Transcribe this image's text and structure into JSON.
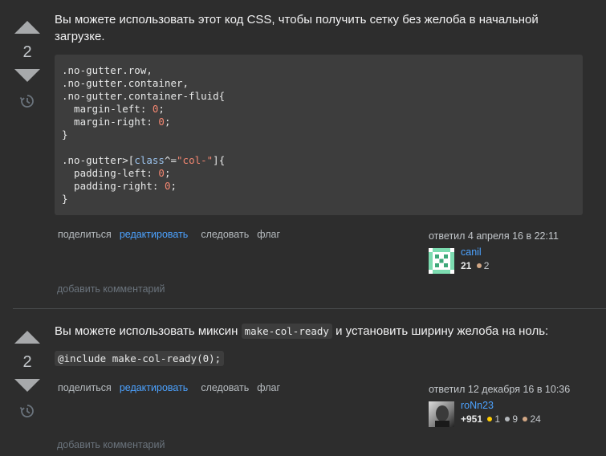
{
  "answers": [
    {
      "votes": "2",
      "text": "Вы можете использовать этот код CSS, чтобы получить сетку без желоба в начальной загрузке.",
      "code": {
        "selector1": ".no-gutter.row,",
        "selector2": ".no-gutter.container,",
        "selector3": ".no-gutter.container-fluid{",
        "prop_ml": "  margin-left: ",
        "prop_mr": "  margin-right: ",
        "zero": "0",
        "semi": ";",
        "close": "}",
        "sel_prefix": ".no-gutter>[",
        "attr": "class",
        "op": "^=",
        "str": "\"col-\"",
        "sel_suffix": "]{",
        "prop_pl": "  padding-left: ",
        "prop_pr": "  padding-right: "
      },
      "menu": {
        "share": "поделиться",
        "edit": "редактировать",
        "follow": "следовать",
        "flag": "флаг"
      },
      "signature": {
        "action": "ответил 4 апреля 16 в 22:11",
        "user": "canil",
        "reputation": "21",
        "bronze": "2"
      },
      "add_comment": "добавить комментарий"
    },
    {
      "votes": "2",
      "text_before": "Вы можете использовать миксин ",
      "inline_code": "make-col-ready",
      "text_after": " и установить ширину желоба на ноль:",
      "code_line": "@include make-col-ready(0);",
      "menu": {
        "share": "поделиться",
        "edit": "редактировать",
        "follow": "следовать",
        "flag": "флаг"
      },
      "signature": {
        "action": "ответил 12 декабря 16 в 10:36",
        "user": "roNn23",
        "reputation": "+951",
        "gold": "1",
        "silver": "9",
        "bronze": "24"
      },
      "add_comment": "добавить комментарий"
    }
  ],
  "colors": {
    "background": "#2d2d2d",
    "link": "#4ca2ff",
    "code_bg": "#3d3d3d",
    "number": "#f48771"
  }
}
